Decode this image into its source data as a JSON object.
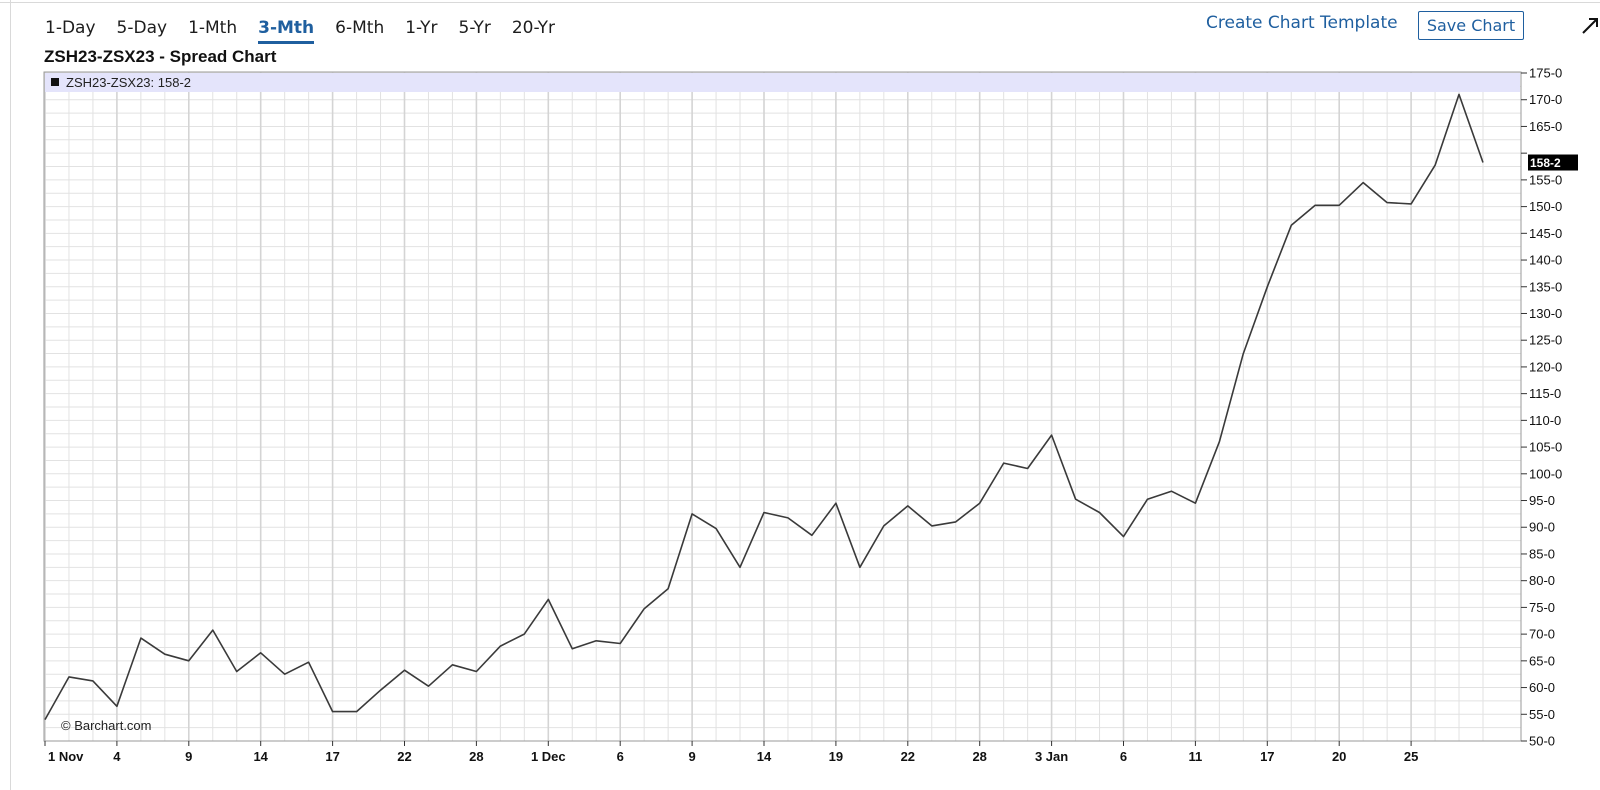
{
  "toolbar": {
    "periods": [
      {
        "label": "1-Day",
        "active": false
      },
      {
        "label": "5-Day",
        "active": false
      },
      {
        "label": "1-Mth",
        "active": false
      },
      {
        "label": "3-Mth",
        "active": true
      },
      {
        "label": "6-Mth",
        "active": false
      },
      {
        "label": "1-Yr",
        "active": false
      },
      {
        "label": "5-Yr",
        "active": false
      },
      {
        "label": "20-Yr",
        "active": false
      }
    ],
    "template_label": "Create Chart Template",
    "save_label": "Save Chart",
    "expand_icon": "expand-arrow-icon"
  },
  "colors": {
    "accent": "#1f5f9f",
    "line": "#3a3a3a",
    "grid": "#e2e2e2",
    "legend_band": "#e4e4fb",
    "price_tag": "#000000"
  },
  "chart_data": {
    "type": "line",
    "title": "ZSH23-ZSX23 - Spread Chart",
    "legend": "ZSH23-ZSX23: 158-2",
    "current_price_label": "158-2",
    "current_price": 158.25,
    "credit": "© Barchart.com",
    "ylim": [
      50,
      175
    ],
    "y_ticks": [
      {
        "value": 175,
        "label": "175-0"
      },
      {
        "value": 170,
        "label": "170-0"
      },
      {
        "value": 165,
        "label": "165-0"
      },
      {
        "value": 160,
        "label": ""
      },
      {
        "value": 155,
        "label": "155-0"
      },
      {
        "value": 150,
        "label": "150-0"
      },
      {
        "value": 145,
        "label": "145-0"
      },
      {
        "value": 140,
        "label": "140-0"
      },
      {
        "value": 135,
        "label": "135-0"
      },
      {
        "value": 130,
        "label": "130-0"
      },
      {
        "value": 125,
        "label": "125-0"
      },
      {
        "value": 120,
        "label": "120-0"
      },
      {
        "value": 115,
        "label": "115-0"
      },
      {
        "value": 110,
        "label": "110-0"
      },
      {
        "value": 105,
        "label": "105-0"
      },
      {
        "value": 100,
        "label": "100-0"
      },
      {
        "value": 95,
        "label": "95-0"
      },
      {
        "value": 90,
        "label": "90-0"
      },
      {
        "value": 85,
        "label": "85-0"
      },
      {
        "value": 80,
        "label": "80-0"
      },
      {
        "value": 75,
        "label": "75-0"
      },
      {
        "value": 70,
        "label": "70-0"
      },
      {
        "value": 65,
        "label": "65-0"
      },
      {
        "value": 60,
        "label": "60-0"
      },
      {
        "value": 55,
        "label": "55-0"
      },
      {
        "value": 50,
        "label": "50-0"
      }
    ],
    "x_ticks": [
      {
        "index": 0,
        "label": "1 Nov"
      },
      {
        "index": 3,
        "label": "4"
      },
      {
        "index": 6,
        "label": "9"
      },
      {
        "index": 9,
        "label": "14"
      },
      {
        "index": 12,
        "label": "17"
      },
      {
        "index": 15,
        "label": "22"
      },
      {
        "index": 18,
        "label": "28"
      },
      {
        "index": 21,
        "label": "1 Dec"
      },
      {
        "index": 24,
        "label": "6"
      },
      {
        "index": 27,
        "label": "9"
      },
      {
        "index": 30,
        "label": "14"
      },
      {
        "index": 33,
        "label": "19"
      },
      {
        "index": 36,
        "label": "22"
      },
      {
        "index": 39,
        "label": "28"
      },
      {
        "index": 42,
        "label": "3 Jan"
      },
      {
        "index": 45,
        "label": "6"
      },
      {
        "index": 48,
        "label": "11"
      },
      {
        "index": 51,
        "label": "17"
      },
      {
        "index": 54,
        "label": "20"
      },
      {
        "index": 57,
        "label": "25"
      }
    ],
    "series": [
      {
        "values": [
          54,
          62,
          61.25,
          56.5,
          69.25,
          66.25,
          65,
          70.75,
          63,
          66.5,
          62.5,
          64.75,
          55.5,
          55.5,
          59.5,
          63.25,
          60.25,
          64.25,
          63,
          67.75,
          70,
          76.5,
          67.25,
          68.75,
          68.25,
          74.75,
          78.5,
          92.5,
          89.75,
          82.5,
          92.75,
          91.75,
          88.5,
          94.5,
          82.5,
          90.25,
          94,
          90.25,
          91,
          94.5,
          102,
          101,
          107.25,
          95.25,
          92.75,
          88.25,
          95.25,
          96.75,
          94.5,
          106,
          122.5,
          135,
          146.5,
          150.25,
          150.25,
          154.5,
          150.75,
          150.5,
          157.75,
          171,
          158.25
        ]
      }
    ]
  }
}
